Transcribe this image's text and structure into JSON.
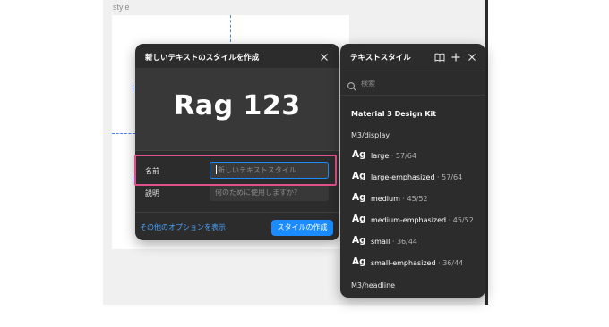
{
  "canvas": {
    "frame_label": "style"
  },
  "dialog": {
    "title": "新しいテキストのスタイルを作成",
    "preview_text": "Rag 123",
    "name_label": "名前",
    "name_placeholder": "新しいテキストスタイル",
    "description_label": "説明",
    "description_placeholder": "何のために使用しますか?",
    "more_options": "その他のオプションを表示",
    "create_button": "スタイルの作成"
  },
  "panel": {
    "title": "テキストスタイル",
    "search_placeholder": "検索",
    "library_name": "Material 3 Design Kit",
    "groups": [
      {
        "name": "M3/display",
        "styles": [
          {
            "sample": "Ag",
            "name": "large",
            "meta": " · 57/64"
          },
          {
            "sample": "Ag",
            "name": "large-emphasized",
            "meta": " · 57/64"
          },
          {
            "sample": "Ag",
            "name": "medium",
            "meta": " · 45/52"
          },
          {
            "sample": "Ag",
            "name": "medium-emphasized",
            "meta": " · 45/52"
          },
          {
            "sample": "Ag",
            "name": "small",
            "meta": " · 36/44"
          },
          {
            "sample": "Ag",
            "name": "small-emphasized",
            "meta": " · 36/44"
          }
        ]
      },
      {
        "name": "M3/headline",
        "styles": []
      }
    ]
  },
  "colors": {
    "accent": "#1a8cff",
    "highlight": "#e0508a",
    "panel_bg": "#2c2c2c"
  },
  "icons": [
    "close-icon",
    "book-icon",
    "plus-icon",
    "search-icon"
  ]
}
